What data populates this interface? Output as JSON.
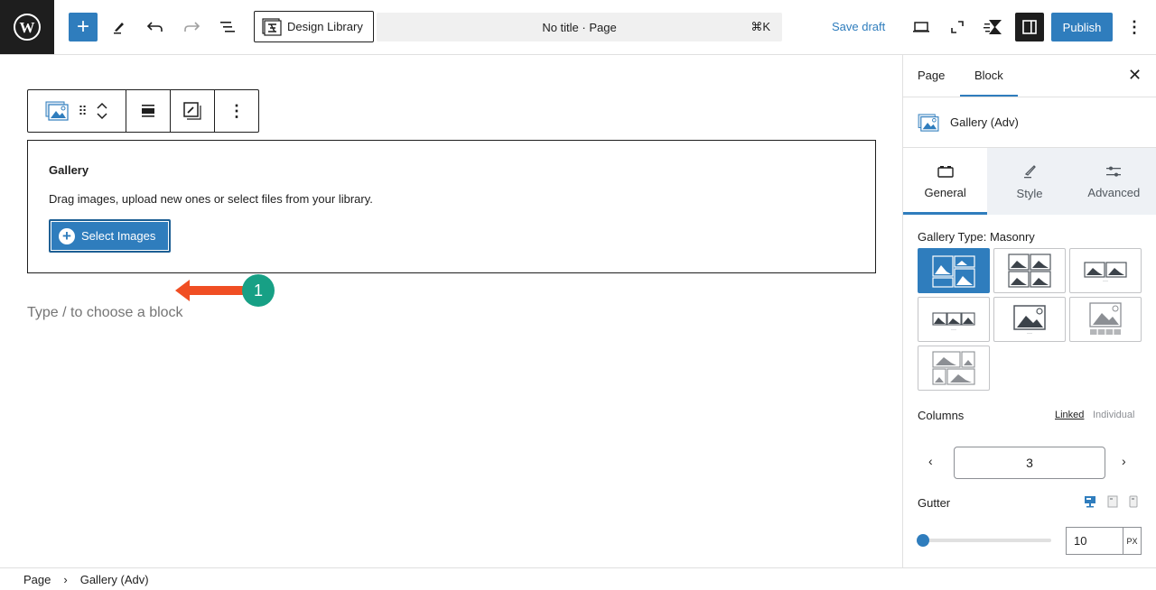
{
  "header": {
    "design_library_label": "Design Library",
    "command_title": "No title · Page",
    "command_shortcut": "⌘K",
    "save_draft_label": "Save draft",
    "publish_label": "Publish"
  },
  "block": {
    "title": "Gallery",
    "description": "Drag images, upload new ones or select files from your library.",
    "select_button_label": "Select Images",
    "annotation_step": "1"
  },
  "canvas": {
    "placeholder": "Type / to choose a block"
  },
  "panel": {
    "tabs": [
      {
        "label": "Page"
      },
      {
        "label": "Block"
      }
    ],
    "active_tab": "Block",
    "block_name": "Gallery (Adv)",
    "inner_tabs": [
      {
        "label": "General"
      },
      {
        "label": "Style"
      },
      {
        "label": "Advanced"
      }
    ],
    "active_inner_tab": "General",
    "gallery_type_label": "Gallery Type: Masonry",
    "gallery_types": [
      "masonry",
      "grid",
      "carousel",
      "carousel-multi",
      "slider",
      "thumbnail-slider",
      "tiles"
    ],
    "selected_gallery_type": "masonry",
    "columns_label": "Columns",
    "linked_label": "Linked",
    "individual_label": "Individual",
    "columns_value": "3",
    "gutter_label": "Gutter",
    "gutter_value": "10",
    "gutter_unit": "PX",
    "gutter_slider_fraction": 0.0,
    "accent_color": "#2f7dbd"
  },
  "footer": {
    "breadcrumb": [
      {
        "label": "Page"
      },
      {
        "label": "Gallery (Adv)"
      }
    ],
    "separator": "›"
  }
}
